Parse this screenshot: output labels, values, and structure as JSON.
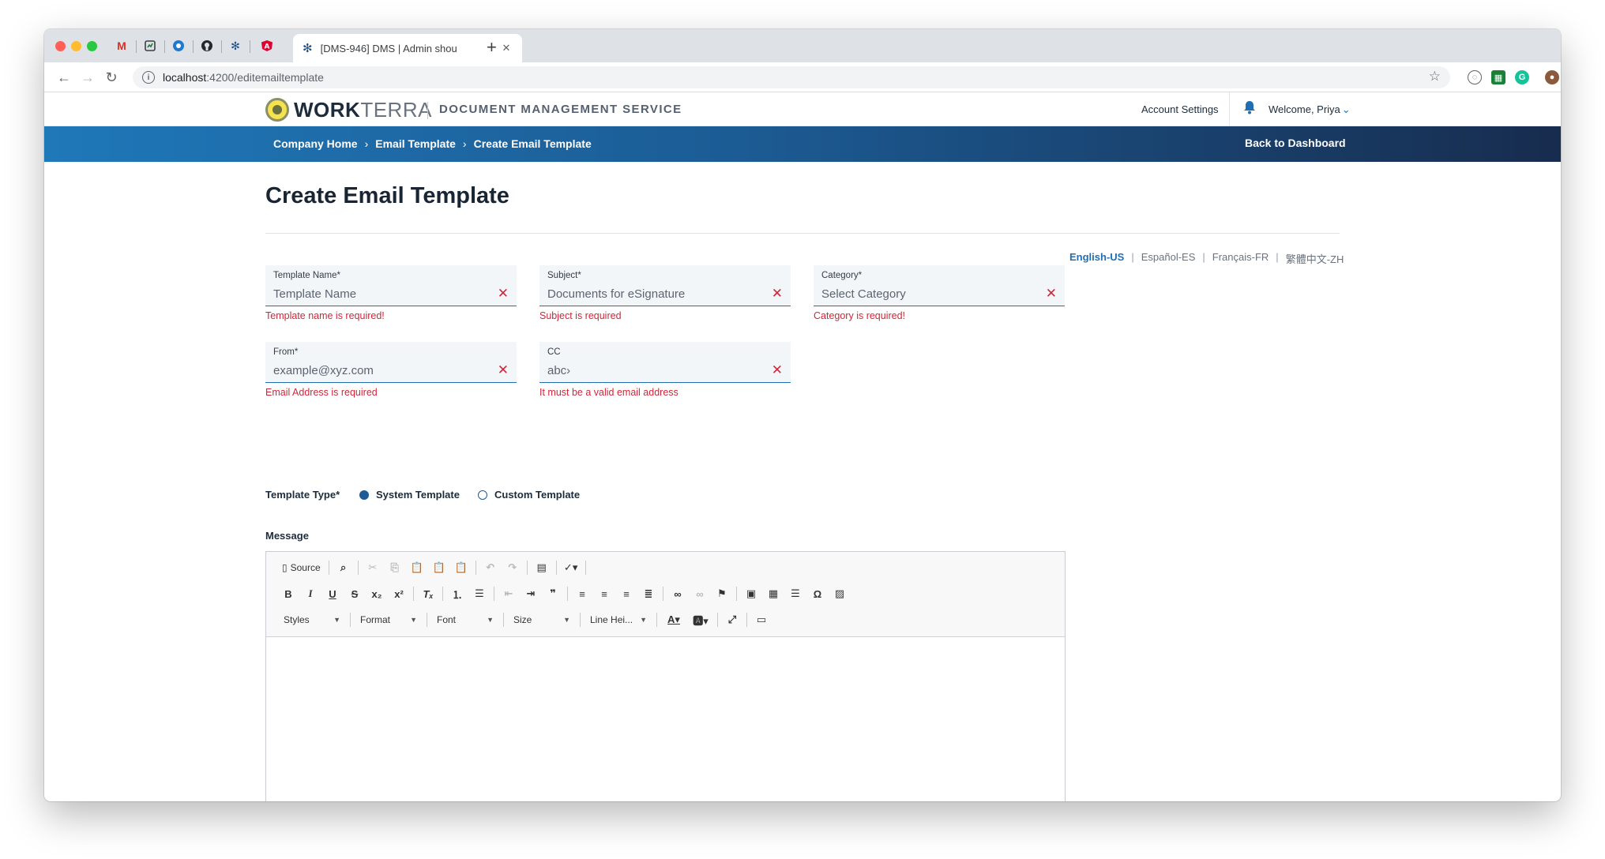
{
  "browser": {
    "active_tab_title": "[DMS-946] DMS | Admin shou",
    "url_host": "localhost",
    "url_path": ":4200/editemailtemplate"
  },
  "header": {
    "brand_bold": "WORK",
    "brand_light": "TERRA",
    "service": "DOCUMENT MANAGEMENT SERVICE",
    "account_settings": "Account Settings",
    "welcome": "Welcome, Priya"
  },
  "breadcrumb": {
    "items": [
      "Company Home",
      "Email Template",
      "Create Email Template"
    ],
    "back": "Back to Dashboard"
  },
  "page": {
    "title": "Create Email Template"
  },
  "languages": [
    "English-US",
    "Español-ES",
    "Français-FR",
    "繁體中文-ZH"
  ],
  "form": {
    "template_name": {
      "label": "Template Name*",
      "value": "Template Name",
      "error": "Template name is required!"
    },
    "subject": {
      "label": "Subject*",
      "value": "Documents for eSignature",
      "error": "Subject is required"
    },
    "category": {
      "label": "Category*",
      "value": "Select Category",
      "error": "Category is required!"
    },
    "from": {
      "label": "From*",
      "value": "example@xyz.com",
      "error": "Email Address is required"
    },
    "cc": {
      "label": "CC",
      "value": "abc›",
      "error": "It must be a valid email address"
    },
    "template_type": {
      "label": "Template Type*",
      "options": [
        "System Template",
        "Custom Template"
      ],
      "selected": "System Template"
    },
    "message_label": "Message"
  },
  "editor": {
    "source": "Source",
    "combos": [
      "Styles",
      "Format",
      "Font",
      "Size",
      "Line Hei..."
    ]
  },
  "colors": {
    "primary": "#1f6fb2",
    "error": "#d0263a",
    "banner_start": "#1f78b8",
    "banner_end": "#172c4e"
  }
}
